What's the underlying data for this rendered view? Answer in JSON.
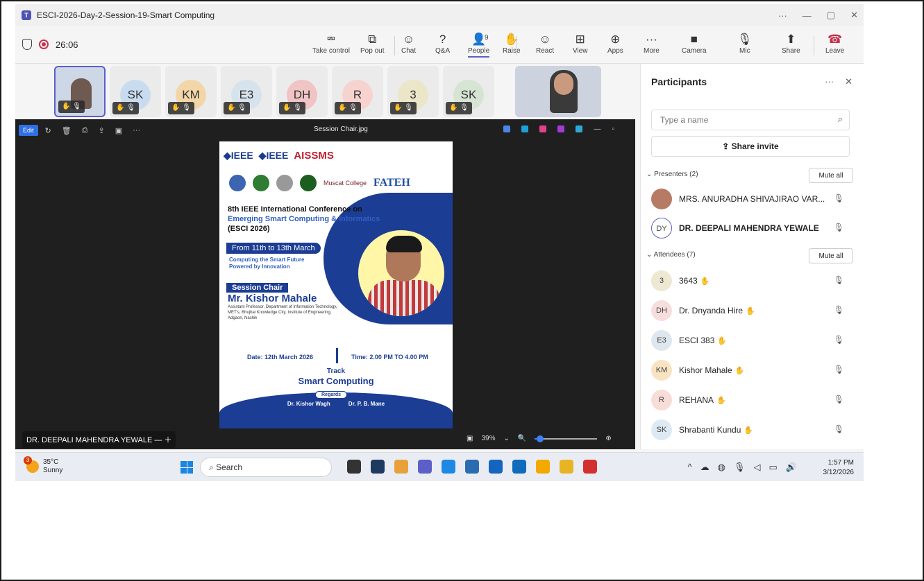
{
  "window": {
    "title": "ESCI-2026-Day-2-Session-19-Smart Computing",
    "controls": [
      "···",
      "—",
      "▢",
      "✕"
    ]
  },
  "meeting": {
    "timer": "26:06",
    "toolbar": [
      {
        "label": "Take control",
        "icon": "take-control-icon",
        "glyph": "⮹"
      },
      {
        "label": "Pop out",
        "icon": "pop-out-icon",
        "glyph": "⧉"
      },
      {
        "label": "Chat",
        "icon": "chat-icon",
        "glyph": "☺"
      },
      {
        "label": "Q&A",
        "icon": "qa-icon",
        "glyph": "?"
      },
      {
        "label": "People",
        "icon": "people-icon",
        "glyph": "👤",
        "count": "9"
      },
      {
        "label": "Raise",
        "icon": "raise-hand-icon",
        "glyph": "✋"
      },
      {
        "label": "React",
        "icon": "react-icon",
        "glyph": "☺"
      },
      {
        "label": "View",
        "icon": "view-icon",
        "glyph": "⊞"
      },
      {
        "label": "Apps",
        "icon": "apps-icon",
        "glyph": "⊕"
      },
      {
        "label": "More",
        "icon": "more-icon",
        "glyph": "···"
      },
      {
        "label": "Camera",
        "icon": "camera-icon",
        "glyph": "■"
      },
      {
        "label": "Mic",
        "icon": "mic-off-icon",
        "glyph": "🎙"
      },
      {
        "label": "Share",
        "icon": "share-icon",
        "glyph": "⬆"
      },
      {
        "label": "Leave",
        "icon": "leave-icon",
        "glyph": "☎"
      }
    ]
  },
  "strip": {
    "tiles": [
      {
        "initials": "",
        "bg": "#cdd7e6"
      },
      {
        "initials": "SK",
        "bg": "#c9dcef"
      },
      {
        "initials": "KM",
        "bg": "#f3d6a8"
      },
      {
        "initials": "E3",
        "bg": "#d7e3ec"
      },
      {
        "initials": "DH",
        "bg": "#f0c4c4"
      },
      {
        "initials": "R",
        "bg": "#f7d3cf"
      },
      {
        "initials": "3",
        "bg": "#ece6c8"
      },
      {
        "initials": "SK",
        "bg": "#d6e4d4"
      }
    ]
  },
  "stage": {
    "edit_label": "Edit",
    "file_title": "Session Chair.jpg",
    "presenter_badge": "DR. DEEPALI MAHENDRA YEWALE",
    "zoom": "39%",
    "zoom_level": 0.09
  },
  "poster": {
    "ieee": "◆IEEE",
    "ieee_pune": "◆IEEE",
    "aissms": "AISSMS",
    "muscat": "Muscat College",
    "fateh": "FATEH",
    "conf_line1": "8th IEEE International Conference on",
    "conf_line2": "Emerging Smart Computing & Informatics",
    "conf_line3": "(ESCI 2026)",
    "dates": "From 11th to 13th March",
    "tag1": "Computing the Smart Future",
    "tag2": "Powered by Innovation",
    "chair_label": "Session Chair",
    "chair_name": "Mr. Kishor Mahale",
    "chair_desc": "Assistant Professor, Department of Information Technology, MET's, Bhujbal Knowledge City, Institute of Engineering, Adgaon, Nashik",
    "date": "Date: 12th March 2026",
    "time": "Time: 2.00 PM TO 4.00 PM",
    "track": "Track",
    "track_name": "Smart Computing",
    "regards": "Regards",
    "signatory1": "Dr. Kishor Wagh",
    "signatory2": "Dr. P. B. Mane"
  },
  "panel": {
    "title": "Participants",
    "search_placeholder": "Type a name",
    "share_invite": "Share invite",
    "presenters_label": "Presenters (2)",
    "attendees_label": "Attendees (7)",
    "mute_all": "Mute all",
    "presenters": [
      {
        "initials": "",
        "name": "MRS. ANURADHA SHIVAJIRAO VAR...",
        "bg": "#b77a64"
      },
      {
        "initials": "DY",
        "name": "DR. DEEPALI MAHENDRA YEWALE",
        "bg": "#ffffff"
      }
    ],
    "attendees": [
      {
        "initials": "3",
        "name": "3643",
        "bg": "#ece8d2"
      },
      {
        "initials": "DH",
        "name": "Dr. Dnyanda Hire",
        "bg": "#f7dede"
      },
      {
        "initials": "E3",
        "name": "ESCI 383",
        "bg": "#dfe7ee"
      },
      {
        "initials": "KM",
        "name": "Kishor Mahale",
        "bg": "#f8e3c2"
      },
      {
        "initials": "R",
        "name": "REHANA",
        "bg": "#f8dcd8"
      },
      {
        "initials": "SK",
        "name": "Shrabanti Kundu",
        "bg": "#dde9f3"
      }
    ]
  },
  "taskbar": {
    "temp": "35°C",
    "condition": "Sunny",
    "badge": "3",
    "search": "Search",
    "time": "1:57 PM",
    "date": "3/12/2026",
    "app_colors": [
      "#333333",
      "#1e3a5f",
      "#e8a13a",
      "#5b5fc7",
      "#1e88e5",
      "#2b6cb0",
      "#1565c0",
      "#0f6cbd",
      "#f2a900",
      "#e8b423",
      "#d32f2f"
    ]
  }
}
